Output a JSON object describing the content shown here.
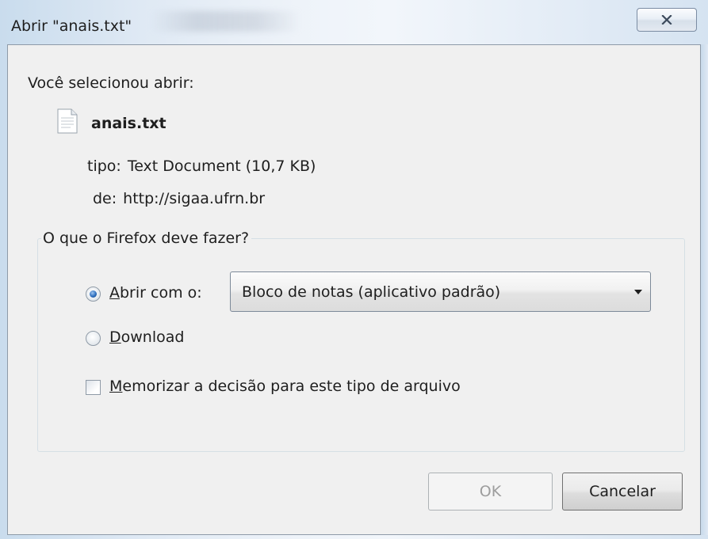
{
  "dialog": {
    "title": "Abrir \"anais.txt\"",
    "close_icon": "close-icon"
  },
  "intro_text": "Você selecionou abrir:",
  "file": {
    "icon": "text-file-icon",
    "name": "anais.txt",
    "type_label": "tipo:",
    "type_value": "Text Document (10,7 KB)",
    "from_label": "de:",
    "from_value": "http://sigaa.ufrn.br"
  },
  "action_group": {
    "legend": "O que o Firefox deve fazer?",
    "open_with": {
      "accesskey": "A",
      "label_rest": "brir com o:",
      "selected": true
    },
    "application_select": {
      "value": "Bloco de notas (aplicativo padrão)"
    },
    "download": {
      "accesskey": "D",
      "label_rest": "ownload",
      "selected": false
    },
    "remember": {
      "accesskey": "M",
      "label_rest": "emorizar a decisão para este tipo de arquivo",
      "checked": false
    }
  },
  "buttons": {
    "ok_label": "OK",
    "ok_enabled": false,
    "cancel_label": "Cancelar"
  }
}
